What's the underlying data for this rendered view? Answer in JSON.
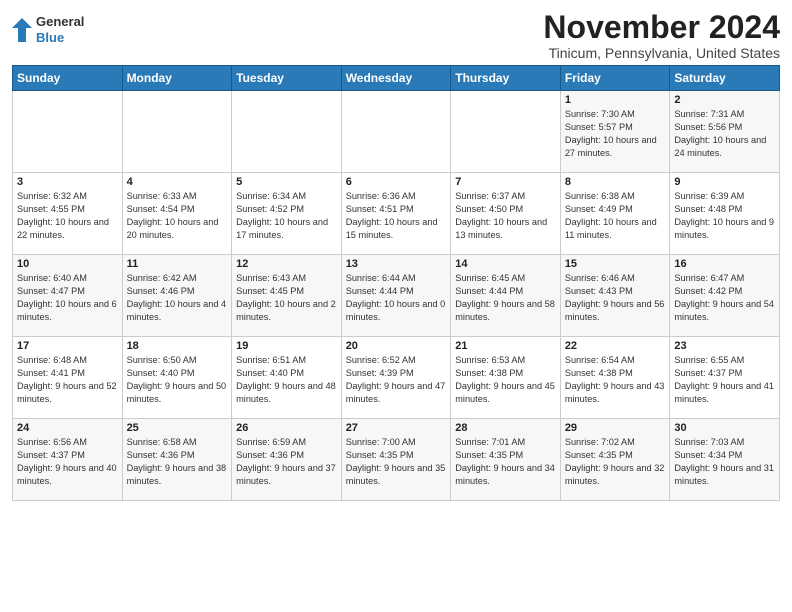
{
  "logo": {
    "line1": "General",
    "line2": "Blue"
  },
  "title": "November 2024",
  "subtitle": "Tinicum, Pennsylvania, United States",
  "days_of_week": [
    "Sunday",
    "Monday",
    "Tuesday",
    "Wednesday",
    "Thursday",
    "Friday",
    "Saturday"
  ],
  "weeks": [
    [
      {
        "day": "",
        "text": ""
      },
      {
        "day": "",
        "text": ""
      },
      {
        "day": "",
        "text": ""
      },
      {
        "day": "",
        "text": ""
      },
      {
        "day": "",
        "text": ""
      },
      {
        "day": "1",
        "text": "Sunrise: 7:30 AM\nSunset: 5:57 PM\nDaylight: 10 hours and 27 minutes."
      },
      {
        "day": "2",
        "text": "Sunrise: 7:31 AM\nSunset: 5:56 PM\nDaylight: 10 hours and 24 minutes."
      }
    ],
    [
      {
        "day": "3",
        "text": "Sunrise: 6:32 AM\nSunset: 4:55 PM\nDaylight: 10 hours and 22 minutes."
      },
      {
        "day": "4",
        "text": "Sunrise: 6:33 AM\nSunset: 4:54 PM\nDaylight: 10 hours and 20 minutes."
      },
      {
        "day": "5",
        "text": "Sunrise: 6:34 AM\nSunset: 4:52 PM\nDaylight: 10 hours and 17 minutes."
      },
      {
        "day": "6",
        "text": "Sunrise: 6:36 AM\nSunset: 4:51 PM\nDaylight: 10 hours and 15 minutes."
      },
      {
        "day": "7",
        "text": "Sunrise: 6:37 AM\nSunset: 4:50 PM\nDaylight: 10 hours and 13 minutes."
      },
      {
        "day": "8",
        "text": "Sunrise: 6:38 AM\nSunset: 4:49 PM\nDaylight: 10 hours and 11 minutes."
      },
      {
        "day": "9",
        "text": "Sunrise: 6:39 AM\nSunset: 4:48 PM\nDaylight: 10 hours and 9 minutes."
      }
    ],
    [
      {
        "day": "10",
        "text": "Sunrise: 6:40 AM\nSunset: 4:47 PM\nDaylight: 10 hours and 6 minutes."
      },
      {
        "day": "11",
        "text": "Sunrise: 6:42 AM\nSunset: 4:46 PM\nDaylight: 10 hours and 4 minutes."
      },
      {
        "day": "12",
        "text": "Sunrise: 6:43 AM\nSunset: 4:45 PM\nDaylight: 10 hours and 2 minutes."
      },
      {
        "day": "13",
        "text": "Sunrise: 6:44 AM\nSunset: 4:44 PM\nDaylight: 10 hours and 0 minutes."
      },
      {
        "day": "14",
        "text": "Sunrise: 6:45 AM\nSunset: 4:44 PM\nDaylight: 9 hours and 58 minutes."
      },
      {
        "day": "15",
        "text": "Sunrise: 6:46 AM\nSunset: 4:43 PM\nDaylight: 9 hours and 56 minutes."
      },
      {
        "day": "16",
        "text": "Sunrise: 6:47 AM\nSunset: 4:42 PM\nDaylight: 9 hours and 54 minutes."
      }
    ],
    [
      {
        "day": "17",
        "text": "Sunrise: 6:48 AM\nSunset: 4:41 PM\nDaylight: 9 hours and 52 minutes."
      },
      {
        "day": "18",
        "text": "Sunrise: 6:50 AM\nSunset: 4:40 PM\nDaylight: 9 hours and 50 minutes."
      },
      {
        "day": "19",
        "text": "Sunrise: 6:51 AM\nSunset: 4:40 PM\nDaylight: 9 hours and 48 minutes."
      },
      {
        "day": "20",
        "text": "Sunrise: 6:52 AM\nSunset: 4:39 PM\nDaylight: 9 hours and 47 minutes."
      },
      {
        "day": "21",
        "text": "Sunrise: 6:53 AM\nSunset: 4:38 PM\nDaylight: 9 hours and 45 minutes."
      },
      {
        "day": "22",
        "text": "Sunrise: 6:54 AM\nSunset: 4:38 PM\nDaylight: 9 hours and 43 minutes."
      },
      {
        "day": "23",
        "text": "Sunrise: 6:55 AM\nSunset: 4:37 PM\nDaylight: 9 hours and 41 minutes."
      }
    ],
    [
      {
        "day": "24",
        "text": "Sunrise: 6:56 AM\nSunset: 4:37 PM\nDaylight: 9 hours and 40 minutes."
      },
      {
        "day": "25",
        "text": "Sunrise: 6:58 AM\nSunset: 4:36 PM\nDaylight: 9 hours and 38 minutes."
      },
      {
        "day": "26",
        "text": "Sunrise: 6:59 AM\nSunset: 4:36 PM\nDaylight: 9 hours and 37 minutes."
      },
      {
        "day": "27",
        "text": "Sunrise: 7:00 AM\nSunset: 4:35 PM\nDaylight: 9 hours and 35 minutes."
      },
      {
        "day": "28",
        "text": "Sunrise: 7:01 AM\nSunset: 4:35 PM\nDaylight: 9 hours and 34 minutes."
      },
      {
        "day": "29",
        "text": "Sunrise: 7:02 AM\nSunset: 4:35 PM\nDaylight: 9 hours and 32 minutes."
      },
      {
        "day": "30",
        "text": "Sunrise: 7:03 AM\nSunset: 4:34 PM\nDaylight: 9 hours and 31 minutes."
      }
    ]
  ]
}
